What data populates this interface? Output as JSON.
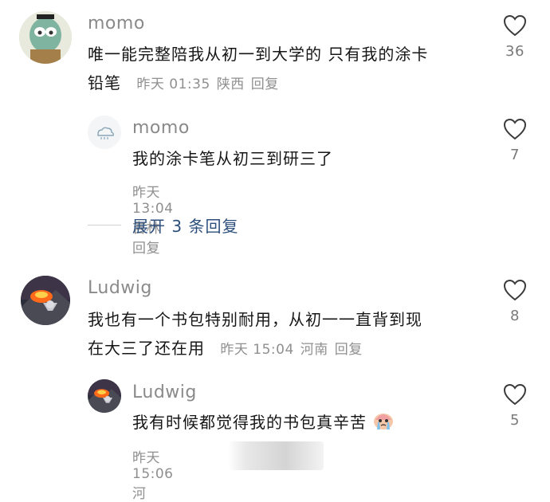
{
  "comments": [
    {
      "username": "momo",
      "text_line1": "唯一能完整陪我从初一到大学的 只有我的涂卡",
      "text_line2": "铅笔",
      "time": "昨天 01:35",
      "location": "陕西",
      "reply_label": "回复",
      "likes": "36",
      "replies": [
        {
          "username": "momo",
          "text": "我的涂卡笔从初三到研三了",
          "time": "昨天 13:04",
          "location": "吉林",
          "reply_label": "回复",
          "likes": "7"
        }
      ],
      "expand_label": "展开 3 条回复"
    },
    {
      "username": "Ludwig",
      "text_line1": "我也有一个书包特别耐用，从初一一直背到现",
      "text_line2": "在大三了还在用",
      "time": "昨天 15:04",
      "location": "河南",
      "reply_label": "回复",
      "likes": "8",
      "replies": [
        {
          "username": "Ludwig",
          "text": "我有时候都觉得我的书包真辛苦",
          "emoji": "crying-face-emoji",
          "time": "昨天 15:06",
          "location": "河",
          "likes": "5"
        }
      ]
    }
  ],
  "icons": {
    "like": "heart-outline-icon"
  },
  "colors": {
    "username": "#8a8a8a",
    "text": "#161616",
    "meta": "#8f8f8f",
    "expand": "#2d4f7c"
  }
}
